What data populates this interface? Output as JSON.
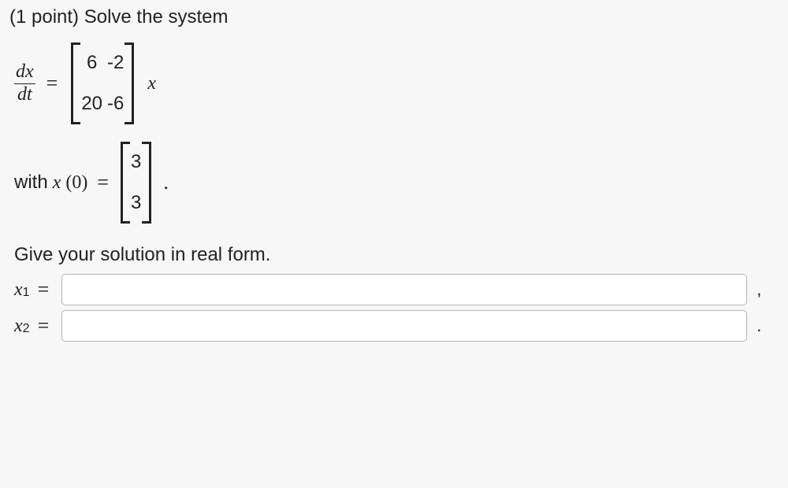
{
  "heading": {
    "points_prefix": "(1 point) ",
    "text": "Solve the system"
  },
  "equation": {
    "lhs_num": "dx",
    "lhs_den": "dt",
    "matrix": {
      "r1c1": "6",
      "r1c2": "-2",
      "r2c1": "20",
      "r2c2": "-6"
    },
    "vector_var": "x"
  },
  "initial": {
    "prefix": "with ",
    "var": "x",
    "arg": "(0)",
    "vec": {
      "r1": "3",
      "r2": "3"
    },
    "suffix": "."
  },
  "instruction": "Give your solution in real form.",
  "answers": {
    "x1": {
      "label_var": "x",
      "label_sub": "1",
      "value": "",
      "trail": ","
    },
    "x2": {
      "label_var": "x",
      "label_sub": "2",
      "value": "",
      "trail": "."
    }
  },
  "eq_sign": "="
}
